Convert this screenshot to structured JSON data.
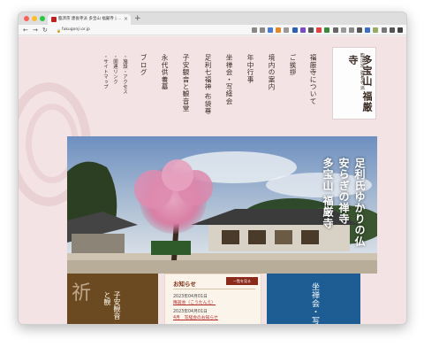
{
  "browser": {
    "tab_title": "臨済宗 建長寺派 多宝山 福厳寺 | ...",
    "tab_close": "×",
    "new_tab": "+",
    "url": "fukugonji.or.jp",
    "back": "←",
    "forward": "→",
    "reload": "↻",
    "ext_icon_colors": [
      "#888888",
      "#888888",
      "#4a7bd0",
      "#e08a2a",
      "#999999",
      "#2b5fb8",
      "#7a4bc2",
      "#555555",
      "#d44",
      "#3a8a3a",
      "#666666",
      "#999999",
      "#888888",
      "#555555",
      "#3d6fc9",
      "#9a6",
      "#777777",
      "#555555",
      "#444444"
    ]
  },
  "site": {
    "logo": {
      "sect": "臨済宗 建長寺派",
      "name": "多宝山 福厳寺"
    },
    "nav": [
      {
        "label": "福厳寺について"
      },
      {
        "label": "ご挨拶"
      },
      {
        "label": "境内の案内"
      },
      {
        "label": "年中行事"
      },
      {
        "label": "坐禅会・写経会"
      },
      {
        "label": "足利七福神 布袋尊"
      },
      {
        "label": "子安観音と観音堂"
      },
      {
        "label": "永代供養墓"
      },
      {
        "label": "ブログ"
      }
    ],
    "subnav": [
      {
        "label": "・施設・アクセス"
      },
      {
        "label": "・関連リンク"
      },
      {
        "label": "・サイトマップ"
      }
    ],
    "hero_caption": [
      "足利氏ゆかりの仏",
      "安らぎの禅寺",
      "多宝山 福厳寺"
    ],
    "cards": {
      "left_char": "祈",
      "left_text": "子安観音と観",
      "news_title": "お知らせ",
      "news_more": "一覧を見る",
      "news": [
        {
          "date": "2023年04月01日",
          "title": "降誕会（こうたんえ）"
        },
        {
          "date": "2023年04月01日",
          "title": "4月　写経会のお知らせ"
        }
      ],
      "right_text": "坐禅会・写"
    }
  }
}
